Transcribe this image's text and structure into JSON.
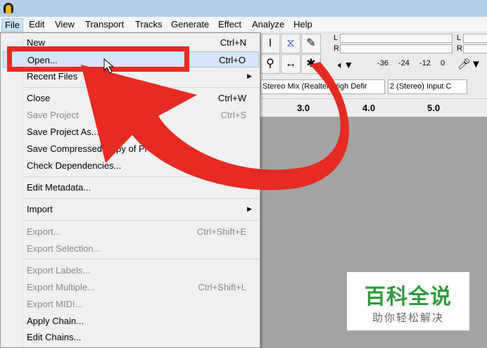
{
  "menubar": [
    "File",
    "Edit",
    "View",
    "Transport",
    "Tracks",
    "Generate",
    "Effect",
    "Analyze",
    "Help"
  ],
  "file_menu": {
    "new": {
      "label": "New",
      "shortcut": "Ctrl+N"
    },
    "open": {
      "label": "Open...",
      "shortcut": "Ctrl+O"
    },
    "recent": {
      "label": "Recent Files"
    },
    "close": {
      "label": "Close",
      "shortcut": "Ctrl+W"
    },
    "save_project": {
      "label": "Save Project",
      "shortcut": "Ctrl+S"
    },
    "save_as": {
      "label": "Save Project As..."
    },
    "save_compressed": {
      "label": "Save Compressed Copy of Project..."
    },
    "check_deps": {
      "label": "Check Dependencies..."
    },
    "edit_metadata": {
      "label": "Edit Metadata..."
    },
    "import": {
      "label": "Import"
    },
    "export": {
      "label": "Export...",
      "shortcut": "Ctrl+Shift+E"
    },
    "export_selection": {
      "label": "Export Selection..."
    },
    "export_labels": {
      "label": "Export Labels..."
    },
    "export_multiple": {
      "label": "Export Multiple...",
      "shortcut": "Ctrl+Shift+L"
    },
    "export_midi": {
      "label": "Export MIDI..."
    },
    "apply_chain": {
      "label": "Apply Chain..."
    },
    "edit_chains": {
      "label": "Edit Chains..."
    }
  },
  "toolbar": {
    "meter_l": "L",
    "meter_r": "R",
    "meter_l2": "L",
    "meter_r2": "R",
    "scale": [
      "-36",
      "-24",
      "-12",
      "0"
    ],
    "input_device": "Stereo Mix (Realtek High Defir",
    "channels": "2 (Stereo) Input C"
  },
  "ruler": [
    "3.0",
    "4.0",
    "5.0"
  ],
  "watermark": {
    "title": "百科全说",
    "subtitle": "助你轻松解决"
  },
  "colors": {
    "annotation": "#e52b23",
    "watermark": "#2e9b3d"
  }
}
